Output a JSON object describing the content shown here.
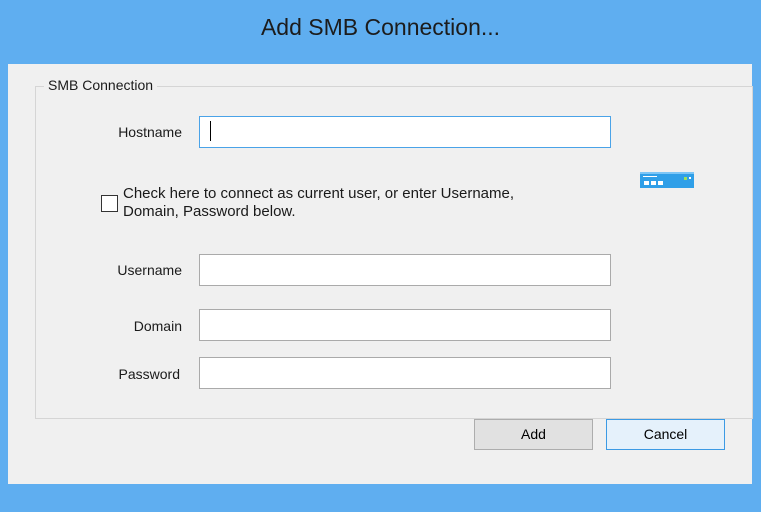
{
  "window": {
    "title": "Add SMB Connection..."
  },
  "group": {
    "label": "SMB Connection"
  },
  "hostname": {
    "label": "Hostname",
    "value": ""
  },
  "current_user": {
    "checked": false,
    "label_line1": "Check here to connect as current user, or enter Username,",
    "label_line2": "Domain, Password below."
  },
  "username": {
    "label": "Username",
    "value": ""
  },
  "domain": {
    "label": "Domain",
    "value": ""
  },
  "password": {
    "label": "Password",
    "value": ""
  },
  "buttons": {
    "add_label": "Add",
    "cancel_label": "Cancel"
  },
  "icons": {
    "server": "network-storage-icon"
  },
  "colors": {
    "titlebar": "#5faef0",
    "client_bg": "#f0f0f0",
    "focus_border": "#4aa3e8"
  }
}
